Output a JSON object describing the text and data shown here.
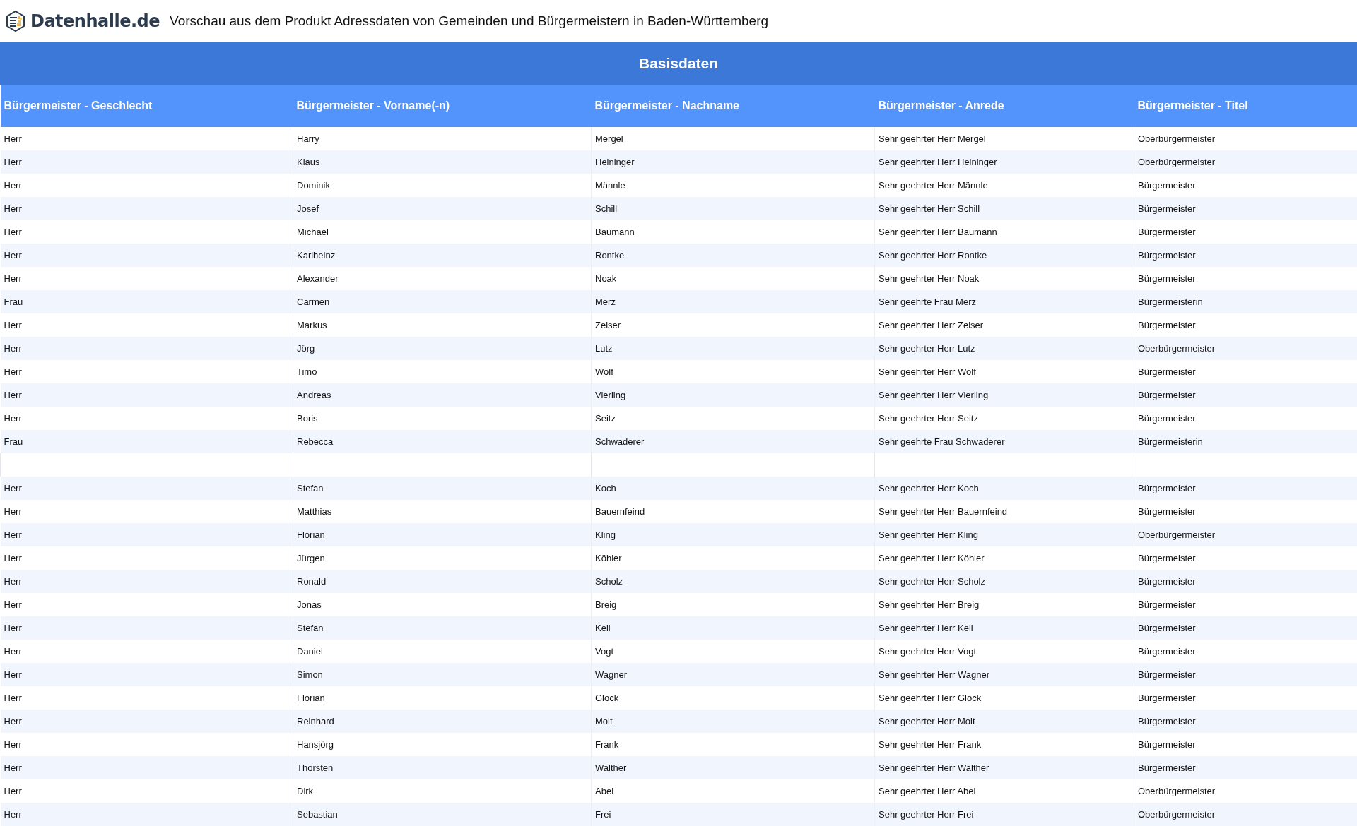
{
  "header": {
    "logo": "Datenhalle.de",
    "title": "Vorschau aus dem Produkt Adressdaten von Gemeinden und Bürgermeistern in Baden-Württemberg"
  },
  "table": {
    "group_title": "Basisdaten",
    "columns": [
      "Bürgermeister - Geschlecht",
      "Bürgermeister - Vorname(-n)",
      "Bürgermeister - Nachname",
      "Bürgermeister - Anrede",
      "Bürgermeister - Titel"
    ],
    "rows": [
      {
        "kind": "data",
        "cells": [
          "Herr",
          "Harry",
          "Mergel",
          "Sehr geehrter Herr Mergel",
          "Oberbürgermeister"
        ]
      },
      {
        "kind": "data",
        "cells": [
          "Herr",
          "Klaus",
          "Heininger",
          "Sehr geehrter Herr Heininger",
          "Oberbürgermeister"
        ]
      },
      {
        "kind": "data",
        "cells": [
          "Herr",
          "Dominik",
          "Männle",
          "Sehr geehrter Herr Männle",
          "Bürgermeister"
        ]
      },
      {
        "kind": "data",
        "cells": [
          "Herr",
          "Josef",
          "Schill",
          "Sehr geehrter Herr Schill",
          "Bürgermeister"
        ]
      },
      {
        "kind": "data",
        "cells": [
          "Herr",
          "Michael",
          "Baumann",
          "Sehr geehrter Herr Baumann",
          "Bürgermeister"
        ]
      },
      {
        "kind": "data",
        "cells": [
          "Herr",
          "Karlheinz",
          "Rontke",
          "Sehr geehrter Herr Rontke",
          "Bürgermeister"
        ]
      },
      {
        "kind": "data",
        "cells": [
          "Herr",
          "Alexander",
          "Noak",
          "Sehr geehrter Herr Noak",
          "Bürgermeister"
        ]
      },
      {
        "kind": "data",
        "cells": [
          "Frau",
          "Carmen",
          "Merz",
          "Sehr geehrte Frau Merz",
          "Bürgermeisterin"
        ]
      },
      {
        "kind": "data",
        "cells": [
          "Herr",
          "Markus",
          "Zeiser",
          "Sehr geehrter Herr Zeiser",
          "Bürgermeister"
        ]
      },
      {
        "kind": "data",
        "cells": [
          "Herr",
          "Jörg",
          "Lutz",
          "Sehr geehrter Herr Lutz",
          "Oberbürgermeister"
        ]
      },
      {
        "kind": "data",
        "cells": [
          "Herr",
          "Timo",
          "Wolf",
          "Sehr geehrter Herr Wolf",
          "Bürgermeister"
        ]
      },
      {
        "kind": "data",
        "cells": [
          "Herr",
          "Andreas",
          "Vierling",
          "Sehr geehrter Herr Vierling",
          "Bürgermeister"
        ]
      },
      {
        "kind": "data",
        "cells": [
          "Herr",
          "Boris",
          "Seitz",
          "Sehr geehrter Herr Seitz",
          "Bürgermeister"
        ]
      },
      {
        "kind": "data",
        "cells": [
          "Frau",
          "Rebecca",
          "Schwaderer",
          "Sehr geehrte Frau Schwaderer",
          "Bürgermeisterin"
        ]
      },
      {
        "kind": "blank"
      },
      {
        "kind": "data",
        "cells": [
          "Herr",
          "Stefan",
          "Koch",
          "Sehr geehrter Herr Koch",
          "Bürgermeister"
        ]
      },
      {
        "kind": "data",
        "cells": [
          "Herr",
          "Matthias",
          "Bauernfeind",
          "Sehr geehrter Herr Bauernfeind",
          "Bürgermeister"
        ]
      },
      {
        "kind": "data",
        "cells": [
          "Herr",
          "Florian",
          "Kling",
          "Sehr geehrter Herr Kling",
          "Oberbürgermeister"
        ]
      },
      {
        "kind": "data",
        "cells": [
          "Herr",
          "Jürgen",
          "Köhler",
          "Sehr geehrter Herr Köhler",
          "Bürgermeister"
        ]
      },
      {
        "kind": "data",
        "cells": [
          "Herr",
          "Ronald",
          "Scholz",
          "Sehr geehrter Herr Scholz",
          "Bürgermeister"
        ]
      },
      {
        "kind": "data",
        "cells": [
          "Herr",
          "Jonas",
          "Breig",
          "Sehr geehrter Herr Breig",
          "Bürgermeister"
        ]
      },
      {
        "kind": "data",
        "cells": [
          "Herr",
          "Stefan",
          "Keil",
          "Sehr geehrter Herr Keil",
          "Bürgermeister"
        ]
      },
      {
        "kind": "data",
        "cells": [
          "Herr",
          "Daniel",
          "Vogt",
          "Sehr geehrter Herr Vogt",
          "Bürgermeister"
        ]
      },
      {
        "kind": "data",
        "cells": [
          "Herr",
          "Simon",
          "Wagner",
          "Sehr geehrter Herr Wagner",
          "Bürgermeister"
        ]
      },
      {
        "kind": "data",
        "cells": [
          "Herr",
          "Florian",
          "Glock",
          "Sehr geehrter Herr Glock",
          "Bürgermeister"
        ]
      },
      {
        "kind": "data",
        "cells": [
          "Herr",
          "Reinhard",
          "Molt",
          "Sehr geehrter Herr Molt",
          "Bürgermeister"
        ]
      },
      {
        "kind": "data",
        "cells": [
          "Herr",
          "Hansjörg",
          "Frank",
          "Sehr geehrter Herr Frank",
          "Bürgermeister"
        ]
      },
      {
        "kind": "data",
        "cells": [
          "Herr",
          "Thorsten",
          "Walther",
          "Sehr geehrter Herr Walther",
          "Bürgermeister"
        ]
      },
      {
        "kind": "data",
        "cells": [
          "Herr",
          "Dirk",
          "Abel",
          "Sehr geehrter Herr Abel",
          "Oberbürgermeister"
        ]
      },
      {
        "kind": "data",
        "cells": [
          "Herr",
          "Sebastian",
          "Frei",
          "Sehr geehrter Herr Frei",
          "Oberbürgermeister"
        ]
      }
    ]
  }
}
